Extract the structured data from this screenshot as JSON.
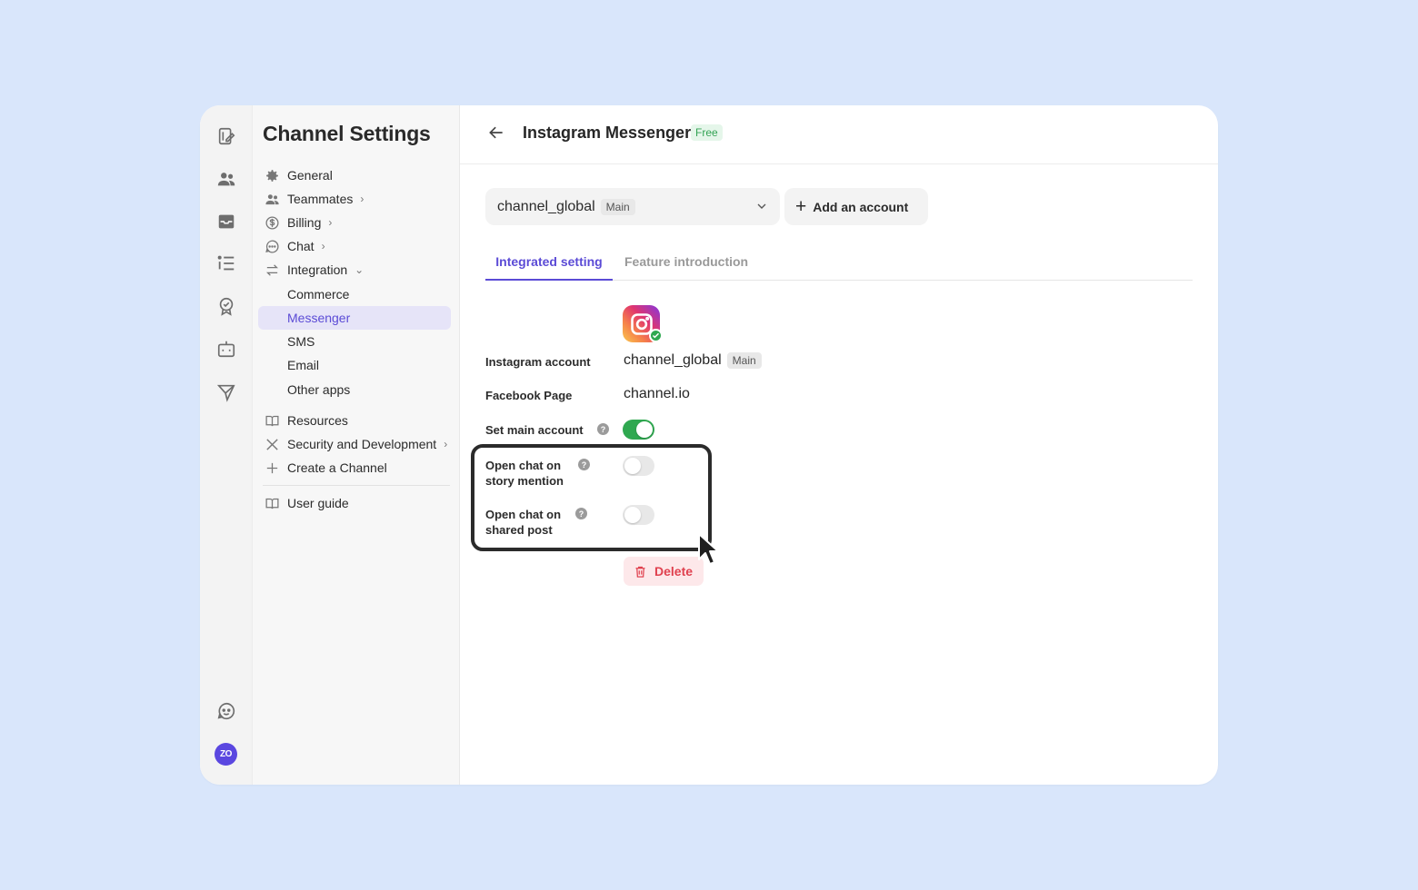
{
  "nav": {
    "title": "Channel Settings",
    "items": [
      {
        "label": "General",
        "icon": "gear-icon"
      },
      {
        "label": "Teammates",
        "icon": "people-icon",
        "chevron": "›"
      },
      {
        "label": "Billing",
        "icon": "dollar-icon",
        "chevron": "›"
      },
      {
        "label": "Chat",
        "icon": "chat-bubble-icon",
        "chevron": "›"
      },
      {
        "label": "Integration",
        "icon": "swap-arrows-icon",
        "chevron": "⌄"
      },
      {
        "label": "Commerce"
      },
      {
        "label": "Messenger",
        "active": true
      },
      {
        "label": "SMS"
      },
      {
        "label": "Email"
      },
      {
        "label": "Other apps"
      },
      {
        "label": "Resources",
        "icon": "book-icon"
      },
      {
        "label": "Security and Development",
        "icon": "tools-icon",
        "chevron": "›"
      },
      {
        "label": "Create a Channel",
        "icon": "plus-icon"
      },
      {
        "label": "User guide",
        "icon": "book-icon"
      }
    ]
  },
  "rail": {
    "avatar_text": "ZO",
    "icons": [
      "compose-icon",
      "people-icon",
      "inbox-icon",
      "list-icon",
      "badge-icon",
      "bot-icon",
      "send-icon",
      "support-icon"
    ]
  },
  "header": {
    "title": "Instagram Messenger",
    "badge": "Free"
  },
  "account_select": {
    "value": "channel_global",
    "tag": "Main"
  },
  "add_account_label": "Add an account",
  "tabs": [
    {
      "label": "Integrated setting",
      "active": true
    },
    {
      "label": "Feature introduction",
      "active": false
    }
  ],
  "settings": {
    "instagram_account_label": "Instagram account",
    "instagram_account_value": "channel_global",
    "instagram_account_tag": "Main",
    "facebook_page_label": "Facebook Page",
    "facebook_page_value": "channel.io",
    "set_main_label": "Set main account",
    "set_main_on": true,
    "story_mention_label_1": "Open chat on",
    "story_mention_label_2": "story mention",
    "story_mention_on": false,
    "shared_post_label_1": "Open chat on",
    "shared_post_label_2": "shared post",
    "shared_post_on": false,
    "help_glyph": "?"
  },
  "delete_label": "Delete",
  "colors": {
    "accent": "#5b4bd6",
    "toggle_on": "#2fa850",
    "danger": "#e0414f",
    "background": "#d9e6fb"
  }
}
